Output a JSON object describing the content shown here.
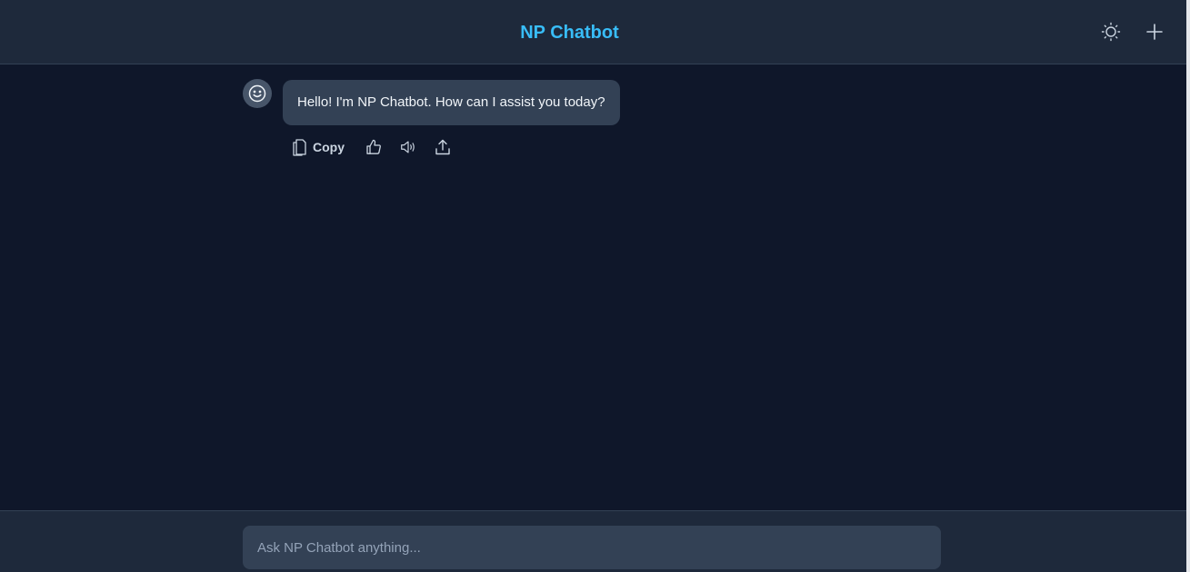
{
  "header": {
    "title": "NP Chatbot",
    "theme_icon": "sun-icon",
    "new_chat_icon": "plus-icon"
  },
  "messages": [
    {
      "role": "bot",
      "avatar_icon": "smiley-icon",
      "text": "Hello! I'm NP Chatbot. How can I assist you today?",
      "actions": {
        "copy_label": "Copy",
        "icons": [
          "copy-icon",
          "thumbs-up-icon",
          "speaker-icon",
          "share-icon"
        ]
      }
    }
  ],
  "composer": {
    "placeholder": "Ask NP Chatbot anything...",
    "value": ""
  },
  "colors": {
    "background": "#0f172a",
    "header": "#1e293b",
    "bubble": "#334155",
    "accent": "#38bdf8"
  }
}
